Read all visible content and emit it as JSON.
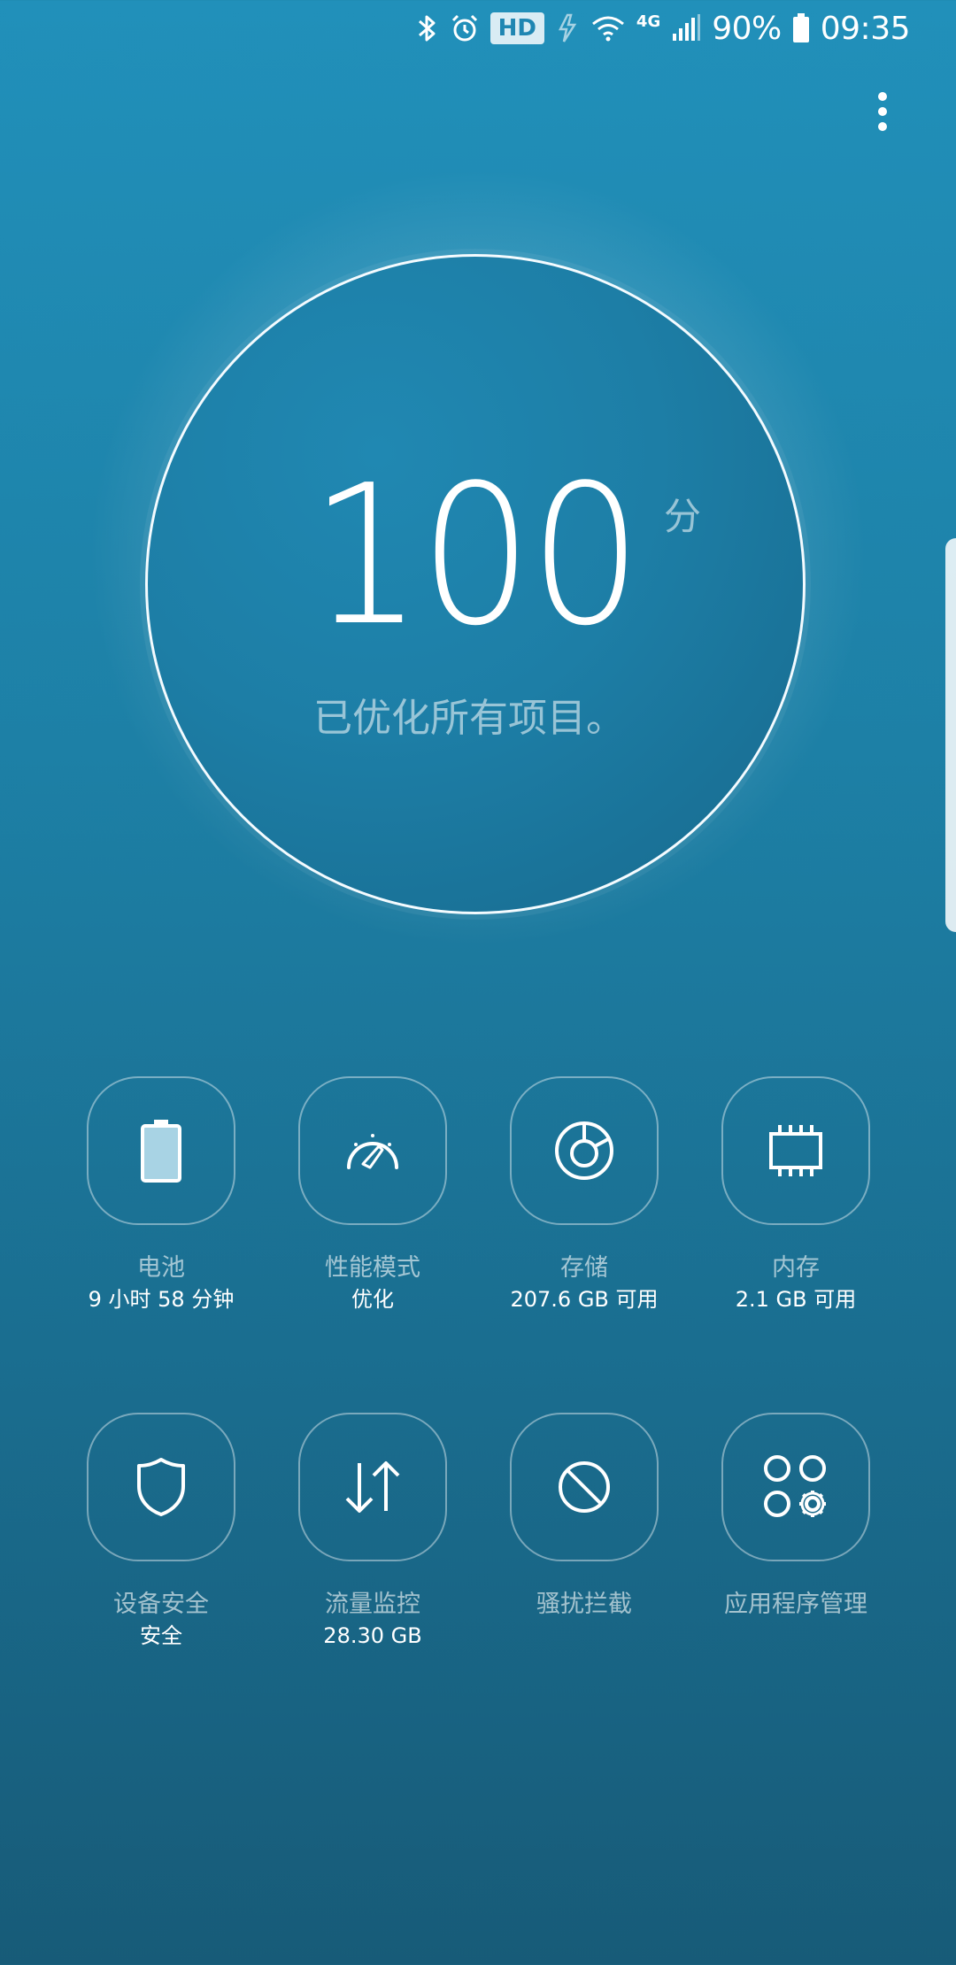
{
  "status_bar": {
    "hd_label": "HD",
    "network_label": "4G",
    "battery_percent": "90%",
    "time": "09:35",
    "icons": [
      "bluetooth-icon",
      "alarm-icon",
      "data-saver-icon",
      "wifi-icon",
      "signal-icon",
      "battery-icon"
    ]
  },
  "score": {
    "value": "100",
    "unit": "分",
    "status": "已优化所有项目。"
  },
  "features": [
    {
      "label": "电池",
      "sub": "9 小时 58 分钟",
      "icon": "battery-icon"
    },
    {
      "label": "性能模式",
      "sub": "优化",
      "icon": "speedometer-icon"
    },
    {
      "label": "存储",
      "sub": "207.6 GB 可用",
      "icon": "storage-icon"
    },
    {
      "label": "内存",
      "sub": "2.1 GB 可用",
      "icon": "memory-chip-icon"
    },
    {
      "label": "设备安全",
      "sub": "安全",
      "icon": "shield-icon"
    },
    {
      "label": "流量监控",
      "sub": "28.30 GB",
      "icon": "data-transfer-icon"
    },
    {
      "label": "骚扰拦截",
      "sub": "",
      "icon": "block-icon"
    },
    {
      "label": "应用程序管理",
      "sub": "",
      "icon": "app-settings-icon"
    }
  ],
  "colors": {
    "background_top": "#2190ba",
    "background_bottom": "#175b78",
    "accent": "#ffffff"
  }
}
